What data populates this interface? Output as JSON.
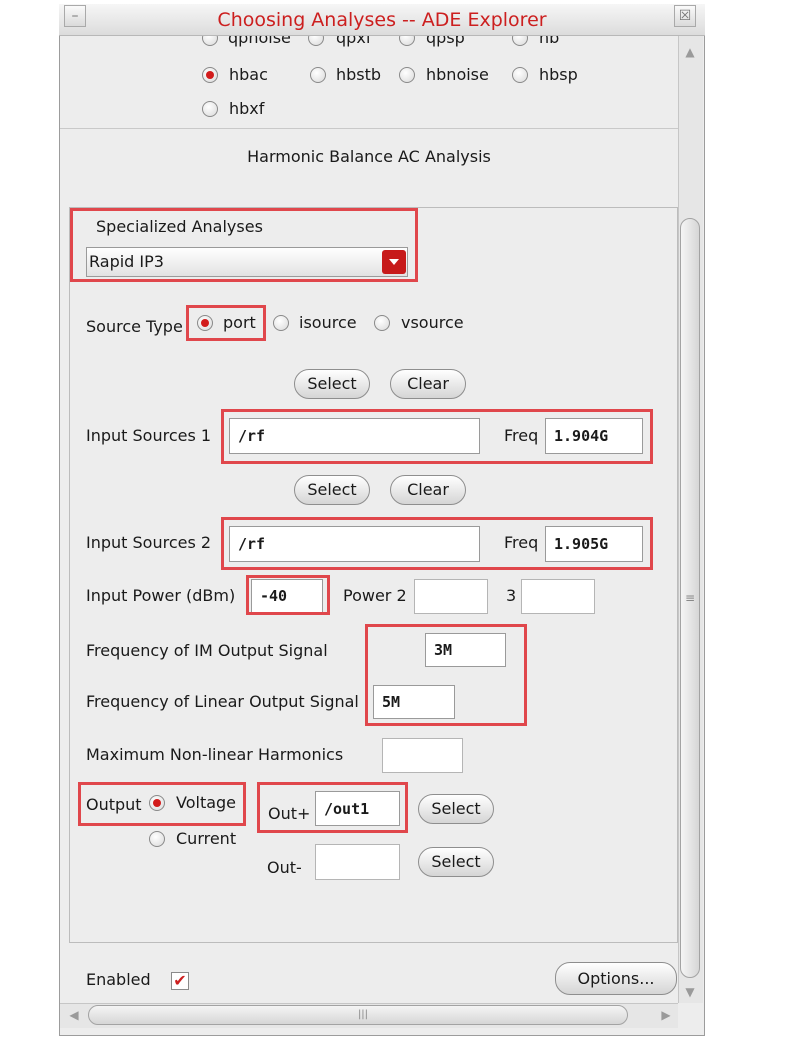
{
  "window": {
    "title": "Choosing Analyses -- ADE Explorer",
    "minimize_glyph": "–",
    "close_glyph": "☒"
  },
  "analyses_row0": [
    "qpnoise",
    "qpxf",
    "qpsp",
    "hb"
  ],
  "analyses_row1": [
    "hbac",
    "hbstb",
    "hbnoise",
    "hbsp"
  ],
  "analyses_row2": [
    "hbxf"
  ],
  "selected_analysis": "hbac",
  "section_title": "Harmonic Balance AC Analysis",
  "specialized": {
    "label": "Specialized Analyses",
    "value": "Rapid IP3"
  },
  "source_type": {
    "label": "Source Type",
    "options": [
      "port",
      "isource",
      "vsource"
    ],
    "selected": "port"
  },
  "buttons": {
    "select": "Select",
    "clear": "Clear",
    "options": "Options..."
  },
  "input1": {
    "label": "Input Sources 1",
    "value": "/rf",
    "freq_label": "Freq",
    "freq": "1.904G"
  },
  "input2": {
    "label": "Input Sources 2",
    "value": "/rf",
    "freq_label": "Freq",
    "freq": "1.905G"
  },
  "power": {
    "label": "Input Power (dBm)",
    "value": "-40",
    "power2_label": "Power 2",
    "power3_label": "3"
  },
  "im_output": {
    "label": "Frequency of IM Output Signal",
    "value": "3M"
  },
  "linear_output": {
    "label": "Frequency of Linear Output Signal",
    "value": "5M"
  },
  "max_harmonics": {
    "label": "Maximum Non-linear Harmonics",
    "value": ""
  },
  "output": {
    "label": "Output",
    "options": [
      "Voltage",
      "Current"
    ],
    "selected": "Voltage",
    "outp_label": "Out+",
    "outp_value": "/out1",
    "outn_label": "Out-",
    "outn_value": ""
  },
  "enabled": {
    "label": "Enabled",
    "checked": true,
    "check_glyph": "✔"
  },
  "scroll": {
    "up": "▲",
    "down": "▼",
    "left": "◀",
    "right": "▶",
    "grip_v": "≡",
    "grip_h": "|||"
  },
  "colors": {
    "title": "#cc1f1f",
    "highlight": "#e0474c",
    "radio_dot": "#d21b1b"
  }
}
